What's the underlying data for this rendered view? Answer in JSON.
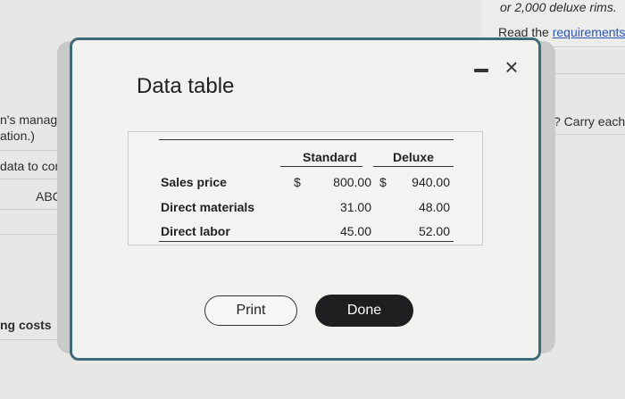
{
  "background": {
    "top_right_line1": "or 2,000 deluxe rims.",
    "top_right_line2_prefix": "Read the ",
    "top_right_line2_link": "requirements",
    "right_text": "? Carry each",
    "left_texts": [
      "n's manag",
      "ation.)",
      "data to com",
      "ABC",
      "ng costs"
    ]
  },
  "modal": {
    "title": "Data table",
    "table": {
      "headers": [
        "Standard",
        "Deluxe"
      ],
      "rows": [
        {
          "label": "Sales price",
          "currency1": "$",
          "standard": "800.00",
          "currency2": "$",
          "deluxe": "940.00"
        },
        {
          "label": "Direct materials",
          "currency1": "",
          "standard": "31.00",
          "currency2": "",
          "deluxe": "48.00"
        },
        {
          "label": "Direct labor",
          "currency1": "",
          "standard": "45.00",
          "currency2": "",
          "deluxe": "52.00"
        }
      ]
    },
    "print_label": "Print",
    "done_label": "Done",
    "close_glyph": "×"
  }
}
